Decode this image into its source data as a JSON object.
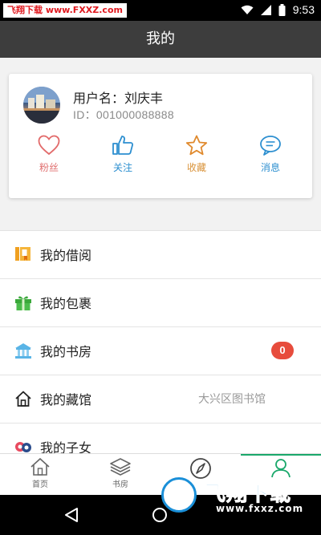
{
  "status_bar": {
    "watermark_red": "飞翔下载",
    "watermark_url": "www.FXXZ.com",
    "time": "9:53",
    "icons": [
      "wifi-icon",
      "signal-icon",
      "battery-icon"
    ]
  },
  "header": {
    "title": "我的"
  },
  "profile": {
    "username": "用户名：刘庆丰",
    "user_id": "ID：001000088888",
    "stats": [
      {
        "label": "粉丝",
        "icon": "heart-icon"
      },
      {
        "label": "关注",
        "icon": "thumbs-up-icon"
      },
      {
        "label": "收藏",
        "icon": "star-icon"
      },
      {
        "label": "消息",
        "icon": "chat-icon"
      }
    ]
  },
  "menu": {
    "items": [
      {
        "label": "我的借阅",
        "icon": "borrow-book-icon"
      },
      {
        "label": "我的包裹",
        "icon": "gift-icon"
      },
      {
        "label": "我的书房",
        "icon": "library-icon",
        "badge": "0"
      },
      {
        "label": "我的藏馆",
        "icon": "home-icon",
        "value": "大兴区图书馆"
      },
      {
        "label": "我的子女",
        "icon": "children-icon"
      }
    ]
  },
  "tabbar": {
    "tabs": [
      {
        "label": "首页",
        "icon": "home-tab-icon"
      },
      {
        "label": "书房",
        "icon": "layers-tab-icon"
      },
      {
        "label": "",
        "icon": "compass-tab-icon"
      },
      {
        "label": "",
        "icon": "person-tab-icon",
        "active": true
      }
    ]
  },
  "watermark_bottom": {
    "text": "飞翔下载",
    "url": "www.fxxz.com"
  },
  "colors": {
    "accent": "#1aa86b",
    "badge": "#e74c3c",
    "header_bg": "#3d3d3d",
    "link_blue": "#2d8fd0"
  }
}
